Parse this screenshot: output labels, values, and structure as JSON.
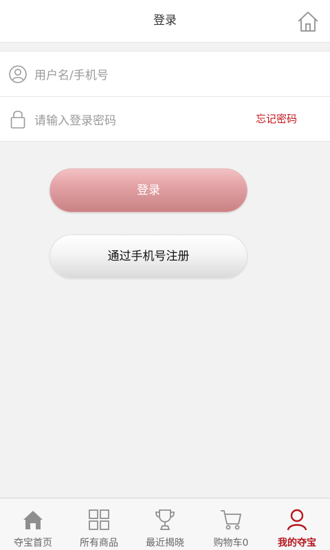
{
  "header": {
    "title": "登录",
    "home_icon": "home-icon"
  },
  "form": {
    "username_placeholder": "用户名/手机号",
    "password_placeholder": "请输入登录密码",
    "forgot_password": "忘记密码"
  },
  "buttons": {
    "login": "登录",
    "register": "通过手机号注册"
  },
  "tabbar": {
    "items": [
      {
        "label": "夺宝首页",
        "icon": "home-icon",
        "active": false
      },
      {
        "label": "所有商品",
        "icon": "grid-icon",
        "active": false
      },
      {
        "label": "最近揭晓",
        "icon": "trophy-icon",
        "active": false
      },
      {
        "label": "购物车0",
        "icon": "cart-icon",
        "active": false
      },
      {
        "label": "我的夺宝",
        "icon": "user-icon",
        "active": true
      }
    ]
  },
  "colors": {
    "accent": "#c4161c",
    "active_tab": "#b5161e",
    "background": "#f2f2f2"
  }
}
